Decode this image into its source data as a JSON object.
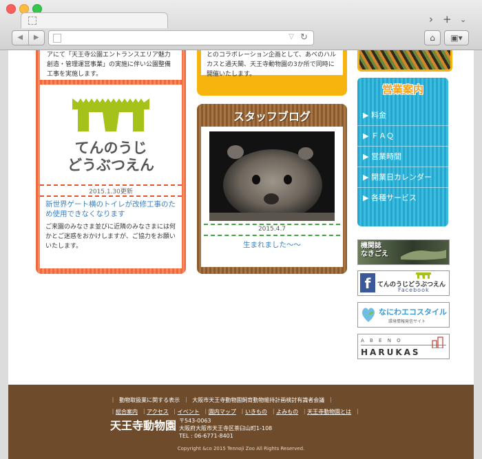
{
  "left": {
    "intro_text": "アにて「天王寺公園エントランスエリア魅力創造・管理運営事業」の実施に伴い公園整備工事を実施します。",
    "logo_line1": "てんのうじ",
    "logo_line2": "どうぶつえん",
    "date": "2015.1.30更新",
    "headline": "新世界ゲート横のトイレが改修工事のため使用できなくなります",
    "body": "ご来園のみなさま並びに近隣のみなさまには何かとご迷惑をおかけしますが、ご協力をお願いいたします。"
  },
  "middle": {
    "intro_text": "とのコラボレーション企画として、あべのハルカスと通天閣、天王寺動物園の3か所で同時に開催いたします。",
    "blog_title": "スタッフブログ",
    "date": "2015.4.7",
    "headline": "生まれました〜〜"
  },
  "right": {
    "info_title": "営業案内",
    "menu": [
      {
        "label": "料金"
      },
      {
        "label": "ＦＡＱ"
      },
      {
        "label": "営業時間"
      },
      {
        "label": "開業日カレンダー"
      },
      {
        "label": "各種サービス"
      }
    ],
    "banners": {
      "kikanbou": "機関誌\nなきごえ",
      "facebook_name": "てんのうじどうぶつえん",
      "facebook_word": "Facebook",
      "eco_title": "なにわエコスタイル",
      "eco_sub": "環境情報発信サイト",
      "harukas_top": "A B E N O",
      "harukas_bottom": "HARUKAS"
    }
  },
  "footer": {
    "row1": [
      "動物取扱業に関する表示",
      "大阪市天王寺動物園飼育動物維持計画検討有識者会議"
    ],
    "row2": [
      "総合案内",
      "アクセス",
      "イベント",
      "園内マップ",
      "いきもの",
      "よみもの",
      "天王寺動物園とは"
    ],
    "org_name": "天王寺動物園",
    "postal": "〒543-0063",
    "address": "大阪府大阪市天王寺区茶臼山町1-108",
    "tel": "TEL : 06-6771-8401",
    "copyright": "Copyright &co 2015 Tennoji Zoo All Rights Reserved."
  },
  "colors": {
    "accent_red": "#ee6a3c",
    "accent_yellow": "#f7b40e",
    "accent_brown": "#8a5a2c",
    "accent_blue": "#23a6d0",
    "footer_bg": "#6e4b2a",
    "link": "#3a7fc1",
    "logo_green": "#a5c21a"
  }
}
